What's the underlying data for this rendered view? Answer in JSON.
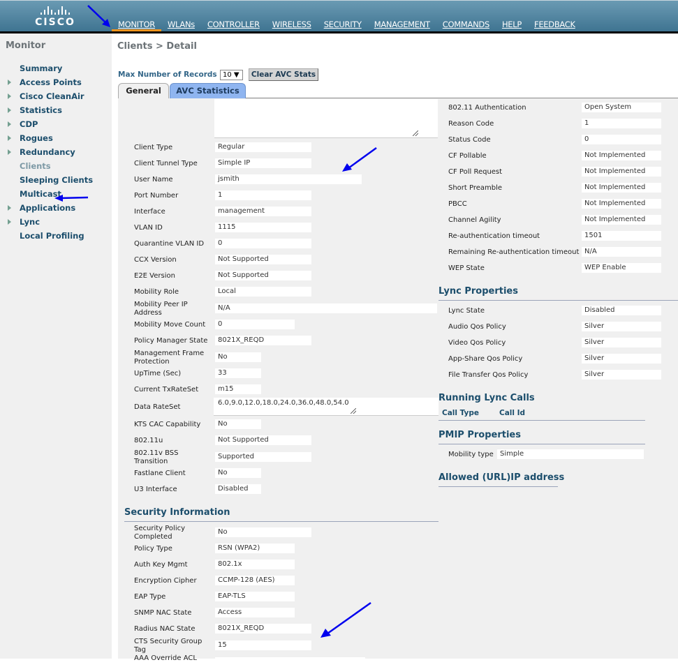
{
  "brand": {
    "logo_text": "CISCO"
  },
  "nav": [
    {
      "label": "MONITOR",
      "active": true
    },
    {
      "label": "WLANs"
    },
    {
      "label": "CONTROLLER"
    },
    {
      "label": "WIRELESS"
    },
    {
      "label": "SECURITY"
    },
    {
      "label": "MANAGEMENT"
    },
    {
      "label": "COMMANDS"
    },
    {
      "label": "HELP"
    },
    {
      "label": "FEEDBACK"
    }
  ],
  "sidebar": {
    "title": "Monitor",
    "items": [
      {
        "label": "Summary",
        "expandable": false
      },
      {
        "label": "Access Points",
        "expandable": true
      },
      {
        "label": "Cisco CleanAir",
        "expandable": true
      },
      {
        "label": "Statistics",
        "expandable": true
      },
      {
        "label": "CDP",
        "expandable": true
      },
      {
        "label": "Rogues",
        "expandable": true
      },
      {
        "label": "Redundancy",
        "expandable": true
      },
      {
        "label": "Clients",
        "expandable": false,
        "active": true
      },
      {
        "label": "Sleeping Clients",
        "expandable": false
      },
      {
        "label": "Multicast",
        "expandable": false
      },
      {
        "label": "Applications",
        "expandable": true
      },
      {
        "label": "Lync",
        "expandable": true
      },
      {
        "label": "Local Profiling",
        "expandable": false
      }
    ]
  },
  "page": {
    "breadcrumb": "Clients > Detail",
    "max_records_label": "Max Number of Records",
    "max_records_value": "10 ▼",
    "clear_button": "Clear AVC Stats",
    "tabs": [
      {
        "label": "General",
        "active": true
      },
      {
        "label": "AVC Statistics"
      }
    ]
  },
  "general": {
    "left_fields": {
      "client_type": {
        "label": "Client Type",
        "value": "Regular"
      },
      "tunnel_type": {
        "label": "Client Tunnel Type",
        "value": "Simple IP"
      },
      "user_name": {
        "label": "User Name",
        "value": "jsmith"
      },
      "port_number": {
        "label": "Port Number",
        "value": "1"
      },
      "interface": {
        "label": "Interface",
        "value": "management"
      },
      "vlan_id": {
        "label": "VLAN ID",
        "value": "1115"
      },
      "quarantine_vlan": {
        "label": "Quarantine VLAN ID",
        "value": "0"
      },
      "ccx_version": {
        "label": "CCX Version",
        "value": "Not Supported"
      },
      "e2e_version": {
        "label": "E2E Version",
        "value": "Not Supported"
      },
      "mobility_role": {
        "label": "Mobility Role",
        "value": "Local"
      },
      "mobility_peer_ip": {
        "label": "Mobility Peer IP Address",
        "value": "N/A"
      },
      "mobility_move_count": {
        "label": "Mobility Move Count",
        "value": "0"
      },
      "policy_manager_state": {
        "label": "Policy Manager State",
        "value": "8021X_REQD"
      },
      "mfp": {
        "label": "Management Frame Protection",
        "value": "No"
      },
      "uptime": {
        "label": "UpTime (Sec)",
        "value": "33"
      },
      "tx_rate_set": {
        "label": "Current TxRateSet",
        "value": "m15"
      },
      "data_rate_set": {
        "label": "Data RateSet",
        "value": "6.0,9.0,12.0,18.0,24.0,36.0,48.0,54.0"
      },
      "kts_cac": {
        "label": "KTS CAC Capability",
        "value": "No"
      },
      "dot11u": {
        "label": "802.11u",
        "value": "Not Supported"
      },
      "dot11v": {
        "label": "802.11v BSS Transition",
        "value": "Supported"
      },
      "fastlane": {
        "label": "Fastlane Client",
        "value": "No"
      },
      "u3": {
        "label": "U3 Interface",
        "value": "Disabled"
      }
    },
    "security": {
      "title": "Security Information",
      "policy_completed": {
        "label": "Security Policy Completed",
        "value": "No"
      },
      "policy_type": {
        "label": "Policy Type",
        "value": "RSN (WPA2)"
      },
      "auth_key_mgmt": {
        "label": "Auth Key Mgmt",
        "value": "802.1x"
      },
      "cipher": {
        "label": "Encryption Cipher",
        "value": "CCMP-128 (AES)"
      },
      "eap_type": {
        "label": "EAP Type",
        "value": "EAP-TLS"
      },
      "snmp_nac": {
        "label": "SNMP NAC State",
        "value": "Access"
      },
      "radius_nac": {
        "label": "Radius NAC State",
        "value": "8021X_REQD"
      },
      "cts_sgt": {
        "label": "CTS Security Group Tag",
        "value": "15"
      },
      "aaa_acl": {
        "label": "AAA Override ACL",
        "value": ""
      }
    },
    "right_fields": {
      "auth": {
        "label": "802.11 Authentication",
        "value": "Open System"
      },
      "reason_code": {
        "label": "Reason Code",
        "value": "1"
      },
      "status_code": {
        "label": "Status Code",
        "value": "0"
      },
      "cf_pollable": {
        "label": "CF Pollable",
        "value": "Not Implemented"
      },
      "cf_poll_request": {
        "label": "CF Poll Request",
        "value": "Not Implemented"
      },
      "short_preamble": {
        "label": "Short Preamble",
        "value": "Not Implemented"
      },
      "pbcc": {
        "label": "PBCC",
        "value": "Not Implemented"
      },
      "channel_agility": {
        "label": "Channel Agility",
        "value": "Not Implemented"
      },
      "reauth_timeout": {
        "label": "Re-authentication timeout",
        "value": "1501"
      },
      "remaining_reauth": {
        "label": "Remaining Re-authentication timeout",
        "value": "N/A"
      },
      "wep_state": {
        "label": "WEP State",
        "value": "WEP Enable"
      }
    },
    "lync": {
      "title": "Lync Properties",
      "state": {
        "label": "Lync State",
        "value": "Disabled"
      },
      "audio": {
        "label": "Audio Qos Policy",
        "value": "Silver"
      },
      "video": {
        "label": "Video Qos Policy",
        "value": "Silver"
      },
      "app_share": {
        "label": "App-Share Qos Policy",
        "value": "Silver"
      },
      "file_transfer": {
        "label": "File Transfer Qos Policy",
        "value": "Silver"
      }
    },
    "running_calls": {
      "title": "Running Lync Calls",
      "columns": [
        "Call Type",
        "Call Id"
      ]
    },
    "pmip": {
      "title": "PMIP Properties",
      "mobility_type": {
        "label": "Mobility type",
        "value": "Simple"
      }
    },
    "allowed_ip": {
      "title": "Allowed (URL)IP address"
    }
  },
  "annotation_color": "#0000ee"
}
